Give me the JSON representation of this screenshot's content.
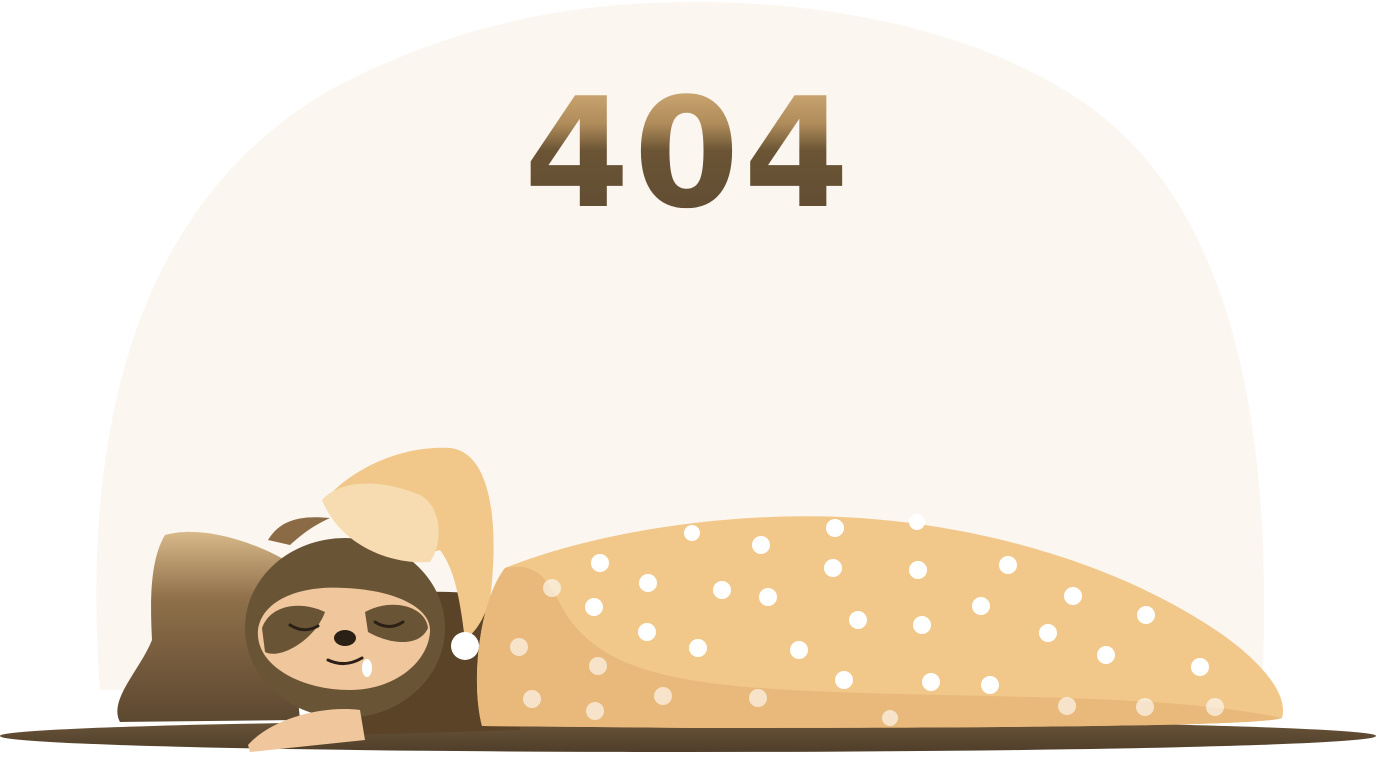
{
  "error": {
    "code": "404"
  },
  "illustration": {
    "subject": "sleeping-sloth-icon",
    "colors": {
      "backdrop": "#fcf6f0",
      "ground": "#5f4b33",
      "blanket": "#f1c88a",
      "blanket_shade": "#e8b97a",
      "nightcap": "#f1c88a",
      "fur_dark": "#6a5436",
      "fur_light": "#9a7a52",
      "face": "#f0c79c",
      "pillow": "#7a6040",
      "dots": "#ffffff"
    }
  }
}
